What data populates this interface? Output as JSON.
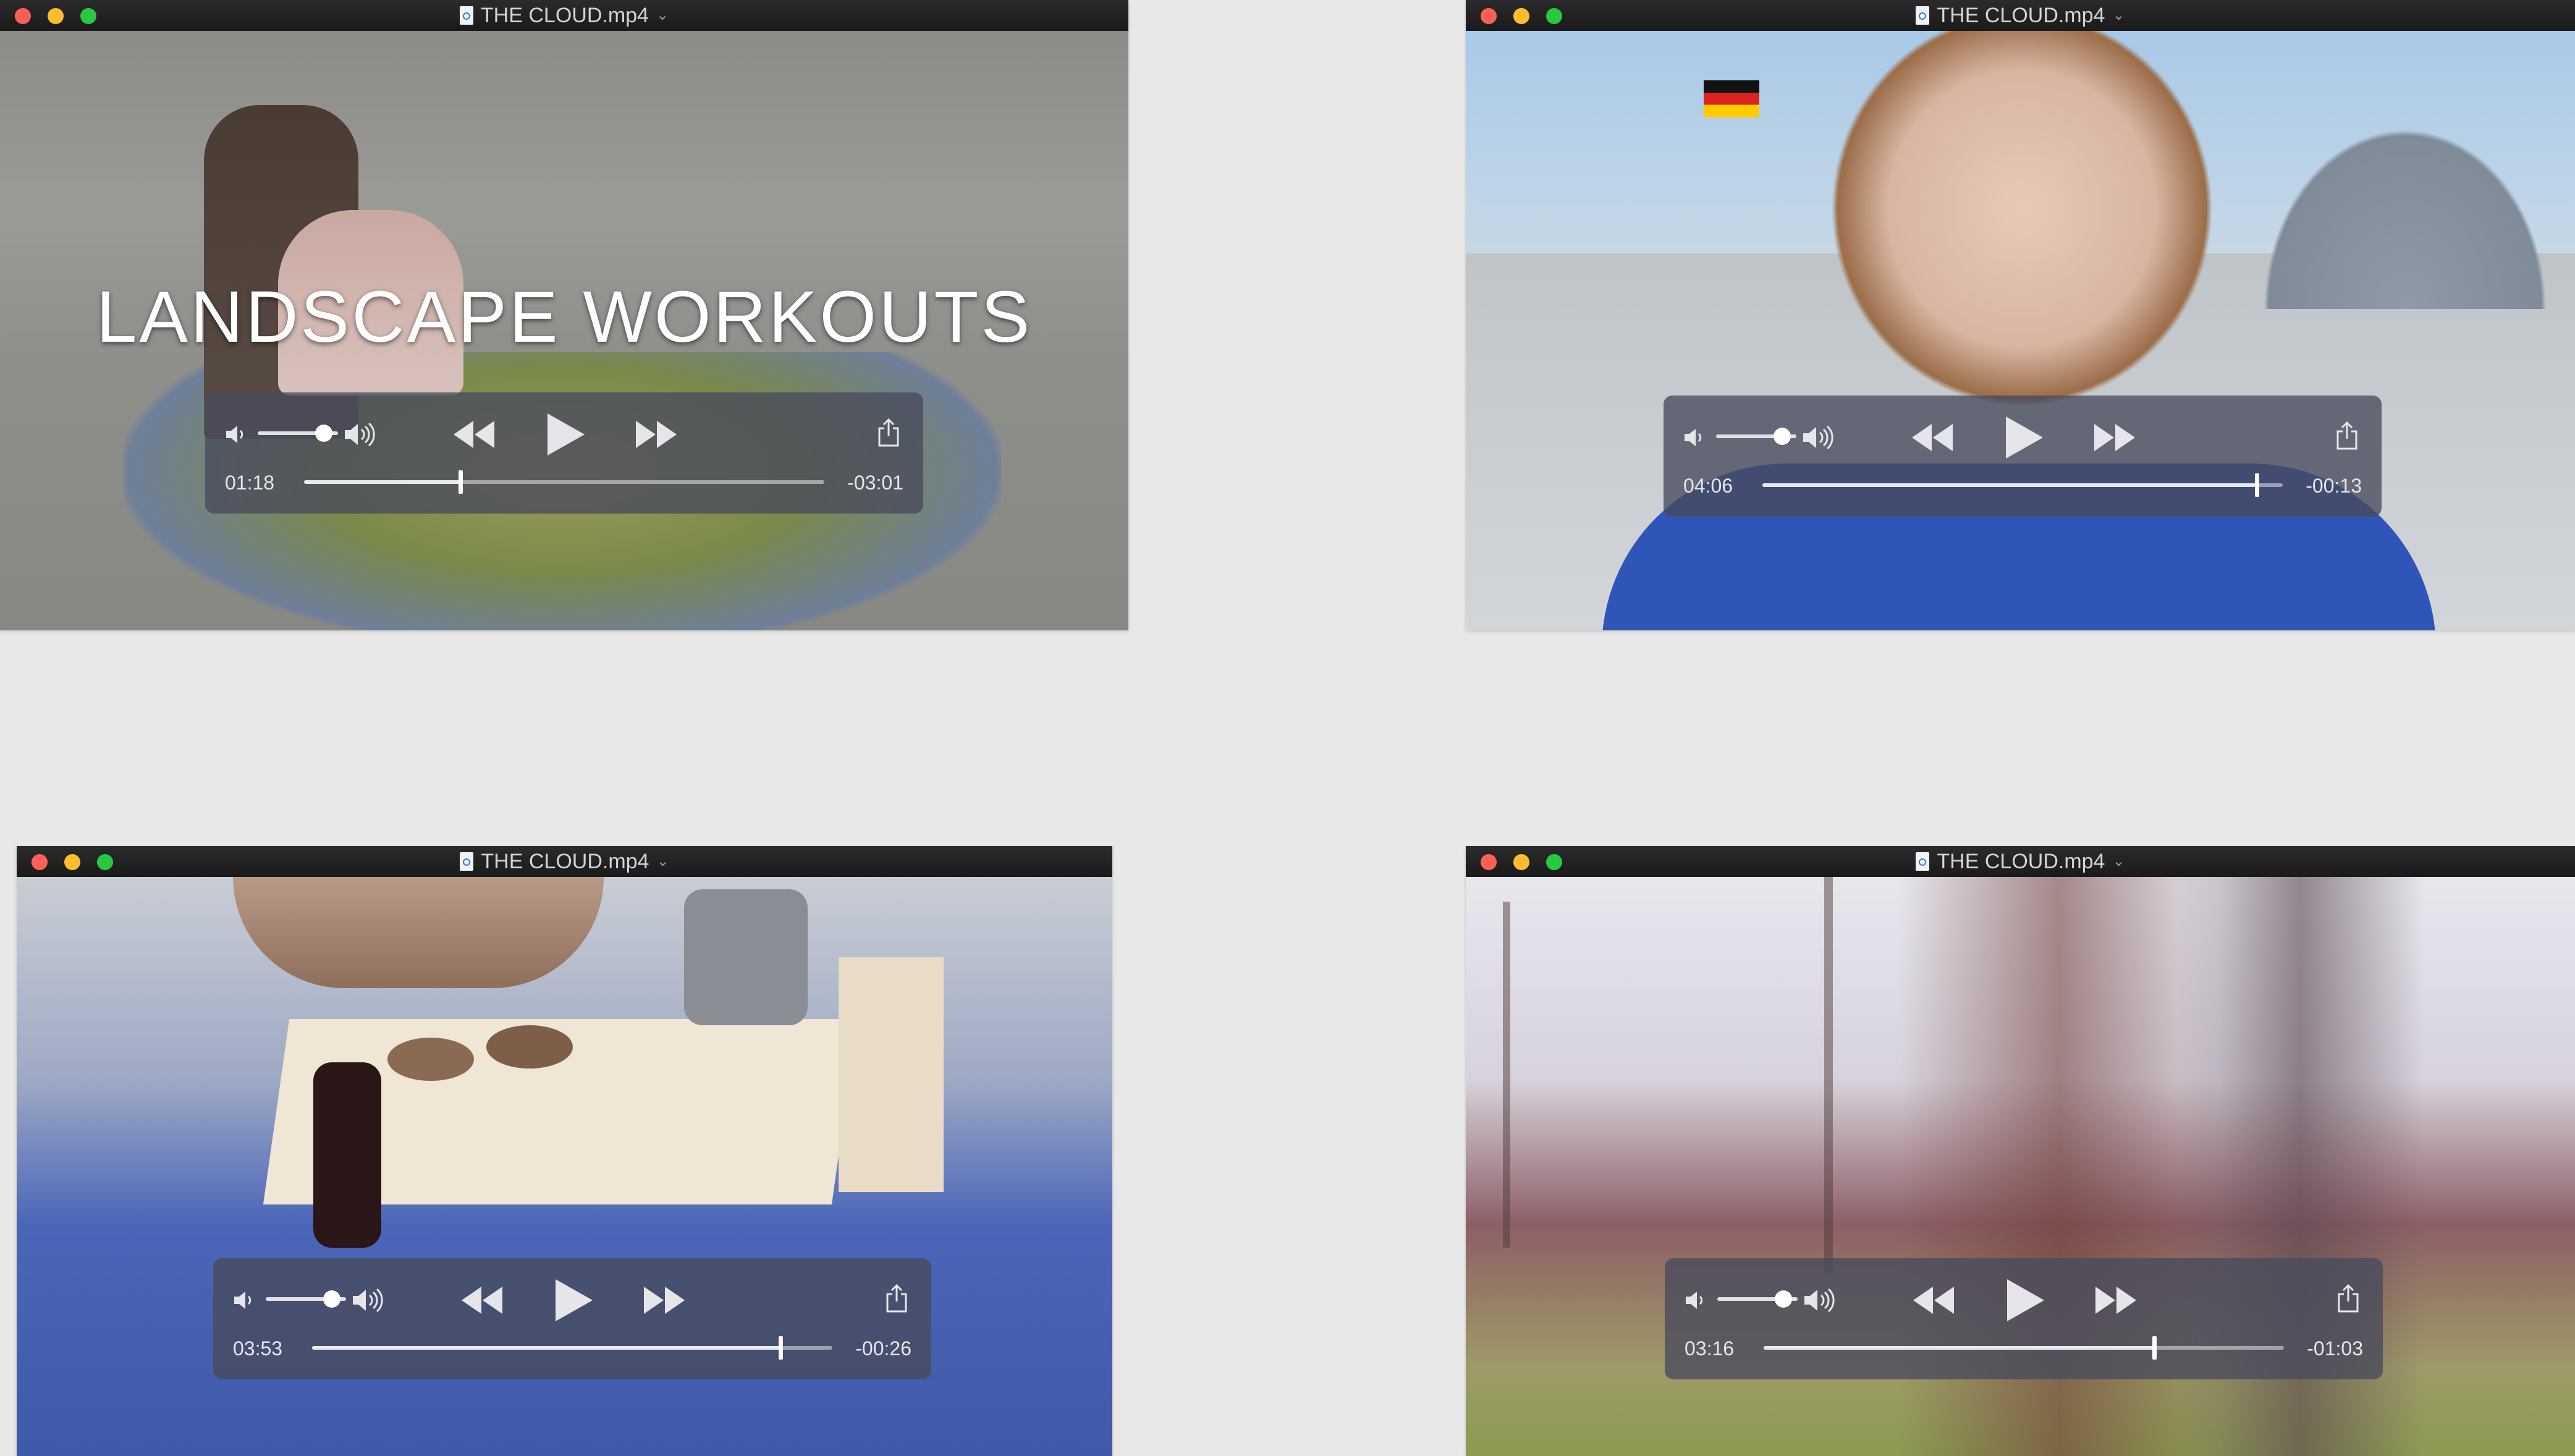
{
  "windows": [
    {
      "title": "THE CLOUD.mp4",
      "overlay_text": "LANDSCAPE WORKOUTS",
      "current_time": "01:18",
      "remaining_time": "-03:01",
      "progress": 0.3
    },
    {
      "title": "THE CLOUD.mp4",
      "current_time": "04:06",
      "remaining_time": "-00:13",
      "progress": 0.95
    },
    {
      "title": "THE CLOUD.mp4",
      "current_time": "03:53",
      "remaining_time": "-00:26",
      "progress": 0.9
    },
    {
      "title": "THE CLOUD.mp4",
      "current_time": "03:16",
      "remaining_time": "-01:03",
      "progress": 0.75
    }
  ],
  "icons": {
    "close": "red-close-icon",
    "minimize": "yellow-minimize-icon",
    "zoom": "green-zoom-icon",
    "file": "quicktime-file-icon",
    "title_menu": "chevron-down-icon",
    "volume_low": "speaker-low-icon",
    "volume_high": "speaker-high-icon",
    "rewind": "rewind-icon",
    "play": "play-icon",
    "fast_forward": "fast-forward-icon",
    "share": "share-icon"
  },
  "colors": {
    "close": "#fe5f57",
    "minimize": "#febc2e",
    "zoom": "#28c840",
    "hud": "#484a5c"
  }
}
